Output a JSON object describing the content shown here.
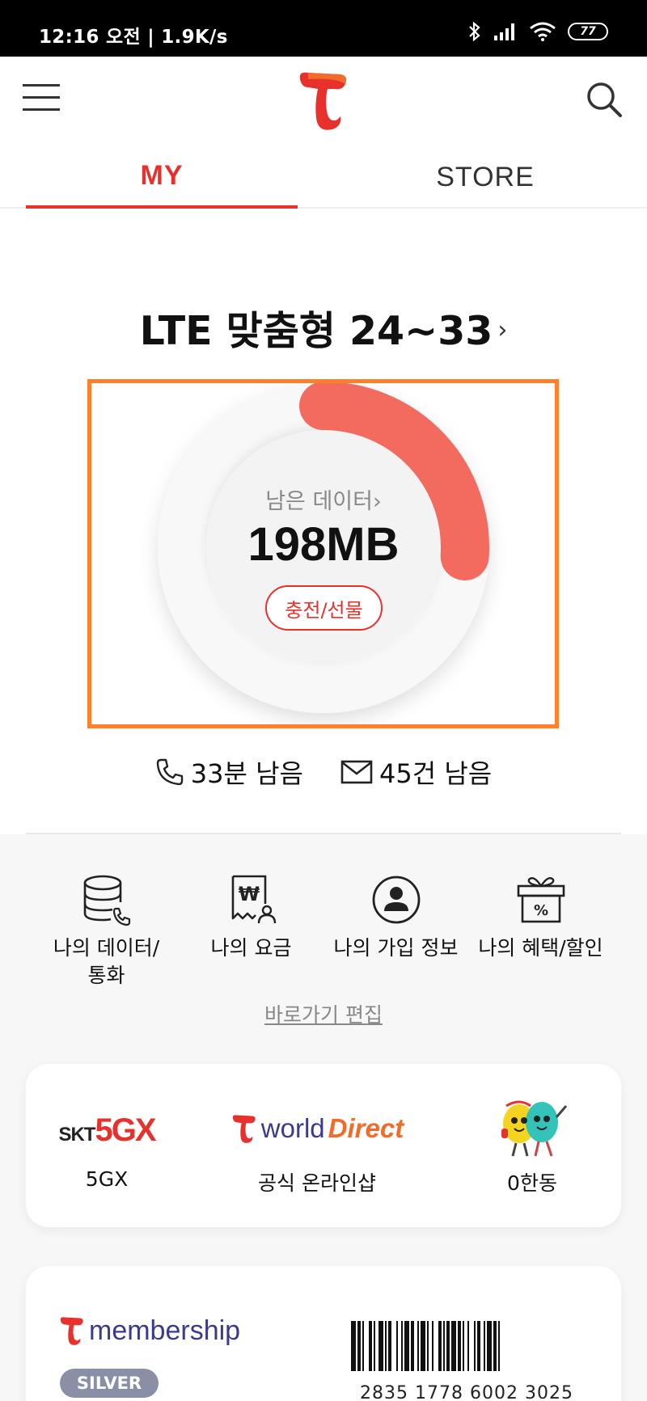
{
  "status_bar": {
    "time": "12:16 오전 | 1.9K/s",
    "battery": "77"
  },
  "tabs": [
    {
      "label": "MY",
      "active": true
    },
    {
      "label": "STORE",
      "active": false
    }
  ],
  "plan": {
    "name": "LTE 맞춤형 24~33",
    "chevron": "›"
  },
  "data_usage": {
    "label": "남은 데이터",
    "chevron": "›",
    "value": "198MB",
    "remaining_fraction": 0.26,
    "charge_label": "충전/선물"
  },
  "usage": {
    "calls": "33분 남음",
    "sms": "45건 남음"
  },
  "shortcuts": [
    {
      "icon": "database-phone-icon",
      "label_line1": "나의 데이터/",
      "label_line2": "통화"
    },
    {
      "icon": "bill-won-icon",
      "label_line1": "나의 요금",
      "label_line2": ""
    },
    {
      "icon": "user-circle-icon",
      "label_line1": "나의 가입 정보",
      "label_line2": ""
    },
    {
      "icon": "gift-percent-icon",
      "label_line1": "나의 혜택/할인",
      "label_line2": ""
    }
  ],
  "edit_shortcuts": "바로가기 편집",
  "brands": [
    {
      "logo_text_1": "SKT",
      "logo_text_2": "5GX",
      "label": "5GX"
    },
    {
      "logo_text_1": "world",
      "logo_text_2": "Direct",
      "label": "공식 온라인샵"
    },
    {
      "logo_text_1": "",
      "logo_text_2": "",
      "label": "0한동"
    }
  ],
  "membership": {
    "logo_text": "membership",
    "grade": "SILVER",
    "barcode_number": "2835 1778 6002 3025"
  },
  "colors": {
    "accent": "#e8312c",
    "donut": "#f26b5e",
    "highlight": "#ff7f2a",
    "grade": "#8a8fa8"
  }
}
